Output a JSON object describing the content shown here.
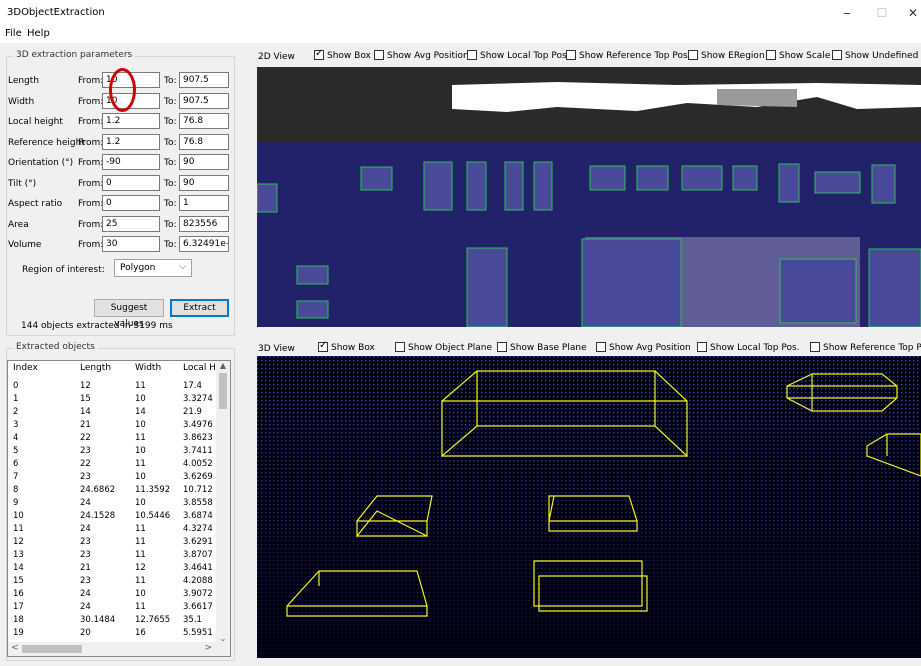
{
  "window": {
    "title": "3DObjectExtraction",
    "minimize": "‒",
    "maximize": "☐",
    "close": "✕"
  },
  "menu": [
    "File",
    "Help"
  ],
  "params": {
    "group_title": "3D extraction parameters",
    "from_label": "From:",
    "to_label": "To:",
    "rows": [
      {
        "label": "Length",
        "from": "10",
        "to": "907.5"
      },
      {
        "label": "Width",
        "from": "10",
        "to": "907.5"
      },
      {
        "label": "Local height",
        "from": "1.2",
        "to": "76.8"
      },
      {
        "label": "Reference height",
        "from": "1.2",
        "to": "76.8"
      },
      {
        "label": "Orientation (°)",
        "from": "-90",
        "to": "90"
      },
      {
        "label": "Tilt (°)",
        "from": "0",
        "to": "90"
      },
      {
        "label": "Aspect ratio",
        "from": "0",
        "to": "1"
      },
      {
        "label": "Area",
        "from": "25",
        "to": "823556"
      },
      {
        "label": "Volume",
        "from": "30",
        "to": "6.32491e+"
      }
    ],
    "roi_label": "Region of interest:",
    "roi_value": "Polygon",
    "suggest_button": "Suggest values",
    "extract_button": "Extract",
    "status": "144 objects extracted in 3199 ms"
  },
  "objects": {
    "group_title": "Extracted objects",
    "columns": [
      "Index",
      "Length",
      "Width",
      "Local H"
    ],
    "rows": [
      [
        "0",
        "12",
        "11",
        "17.4"
      ],
      [
        "1",
        "15",
        "10",
        "3.3274"
      ],
      [
        "2",
        "14",
        "14",
        "21.9"
      ],
      [
        "3",
        "21",
        "10",
        "3.4976"
      ],
      [
        "4",
        "22",
        "11",
        "3.8623"
      ],
      [
        "5",
        "23",
        "10",
        "3.7411"
      ],
      [
        "6",
        "22",
        "11",
        "4.0052"
      ],
      [
        "7",
        "23",
        "10",
        "3.6269"
      ],
      [
        "8",
        "24.6862",
        "11.3592",
        "10.712"
      ],
      [
        "9",
        "24",
        "10",
        "3.8558"
      ],
      [
        "10",
        "24.1528",
        "10.5446",
        "3.6874"
      ],
      [
        "11",
        "24",
        "11",
        "4.3274"
      ],
      [
        "12",
        "23",
        "11",
        "3.6291"
      ],
      [
        "13",
        "23",
        "11",
        "3.8707"
      ],
      [
        "14",
        "21",
        "12",
        "3.4641"
      ],
      [
        "15",
        "23",
        "11",
        "4.2088"
      ],
      [
        "16",
        "24",
        "10",
        "3.9072"
      ],
      [
        "17",
        "24",
        "11",
        "3.6617"
      ],
      [
        "18",
        "30.1484",
        "12.7655",
        "35.1"
      ],
      [
        "19",
        "20",
        "16",
        "5.5951"
      ]
    ]
  },
  "view2d": {
    "title": "2D View",
    "options": [
      {
        "label": "Show Box",
        "checked": true
      },
      {
        "label": "Show Avg Position",
        "checked": false
      },
      {
        "label": "Show Local Top Pos.",
        "checked": false
      },
      {
        "label": "Show Reference Top Pos.",
        "checked": false
      },
      {
        "label": "Show ERegion",
        "checked": false
      },
      {
        "label": "Show Scale",
        "checked": false
      },
      {
        "label": "Show Undefined",
        "checked": false
      }
    ]
  },
  "view3d": {
    "title": "3D View",
    "options": [
      {
        "label": "Show Box",
        "checked": true
      },
      {
        "label": "Show Object Plane",
        "checked": false
      },
      {
        "label": "Show Base Plane",
        "checked": false
      },
      {
        "label": "Show Avg Position",
        "checked": false
      },
      {
        "label": "Show Local Top Pos.",
        "checked": false
      },
      {
        "label": "Show Reference Top Pos.",
        "checked": false
      }
    ]
  },
  "icons": {
    "dropdown": "chevron-down-icon",
    "scroll_up": "scroll-up-arrow-icon",
    "scroll_down": "scroll-down-arrow-icon",
    "scroll_left": "scroll-left-arrow-icon",
    "scroll_right": "scroll-right-arrow-icon"
  },
  "colors": {
    "box_2d": "#2fbf5a",
    "box_3d": "#f2f21a",
    "annotation_circle": "#d00000",
    "background_2d": "#1b1b5e"
  }
}
